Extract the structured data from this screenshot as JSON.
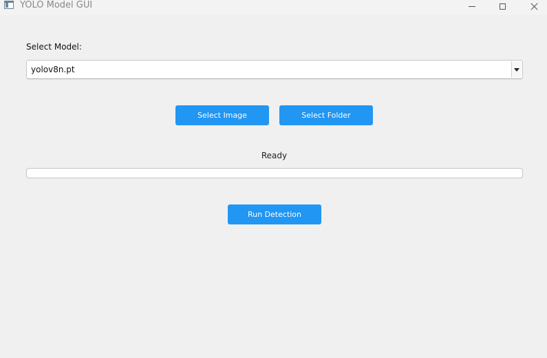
{
  "window": {
    "title": "YOLO Model GUI"
  },
  "model": {
    "label": "Select Model:",
    "selected": "yolov8n.pt"
  },
  "buttons": {
    "select_image": "Select Image",
    "select_folder": "Select Folder",
    "run_detection": "Run Detection"
  },
  "status": {
    "text": "Ready",
    "progress": 0
  },
  "colors": {
    "accent": "#2196f3",
    "background": "#f0f0f0"
  }
}
